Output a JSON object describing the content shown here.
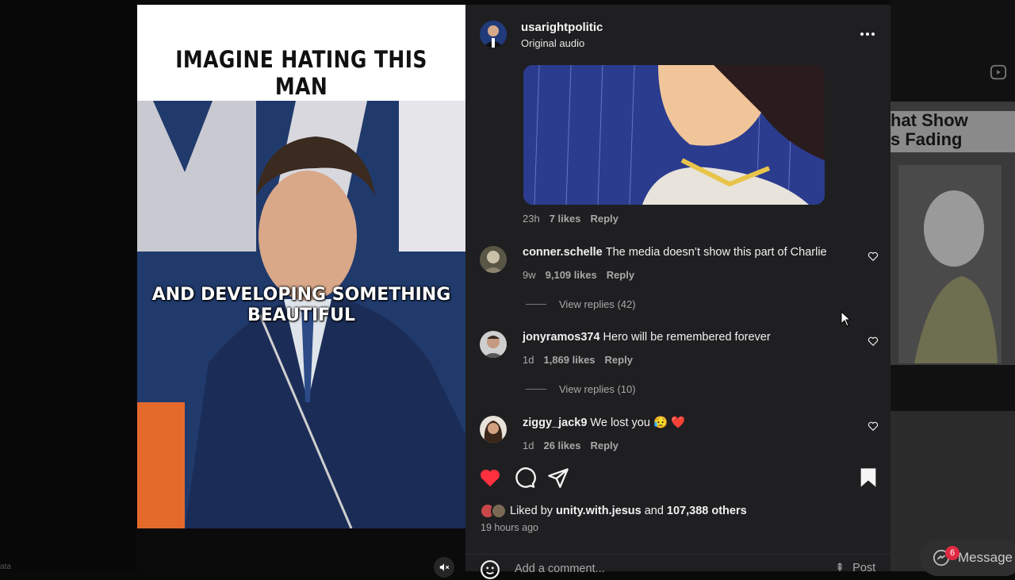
{
  "post": {
    "username": "usarightpolitic",
    "audio": "Original audio",
    "media_headline": "IMAGINE HATING THIS MAN",
    "media_subtitle_line1": "AND DEVELOPING SOMETHING",
    "media_subtitle_line2": "BEAUTIFUL"
  },
  "first_reply_meta": {
    "time": "23h",
    "likes": "7 likes",
    "reply": "Reply"
  },
  "comments": [
    {
      "username": "conner.schelle",
      "text": "The media doesn’t show this part of Charlie",
      "time": "9w",
      "likes": "9,109 likes",
      "reply": "Reply",
      "view_replies": "View replies (42)"
    },
    {
      "username": "jonyramos374",
      "text": "Hero will be remembered forever",
      "time": "1d",
      "likes": "1,869 likes",
      "reply": "Reply",
      "view_replies": "View replies (10)"
    },
    {
      "username": "ziggy_jack9",
      "text": "We lost you 😥 ❤️",
      "time": "1d",
      "likes": "26 likes",
      "reply": "Reply"
    }
  ],
  "likes_summary": {
    "prefix": "Liked by",
    "liker": "unity.with.jesus",
    "and": "and",
    "others": "107,388 others"
  },
  "time_ago": "19 hours ago",
  "add_comment": {
    "placeholder": "Add a comment...",
    "post_label": "Post"
  },
  "background": {
    "card_caption_line1": "hat Show",
    "card_caption_line2": "s Fading",
    "messages_label": "Message",
    "messages_badge": "6",
    "left_edge_text": "ata"
  },
  "icons": [
    "more-options-icon",
    "heart-icon",
    "comment-icon",
    "share-icon",
    "bookmark-icon",
    "emoji-icon",
    "mute-icon",
    "reels-icon",
    "messenger-icon",
    "mouse-cursor-icon"
  ],
  "colors": {
    "panel_bg": "#1f1f21",
    "liked_heart": "#ff3040",
    "meta_gray": "#a8a8a8"
  }
}
